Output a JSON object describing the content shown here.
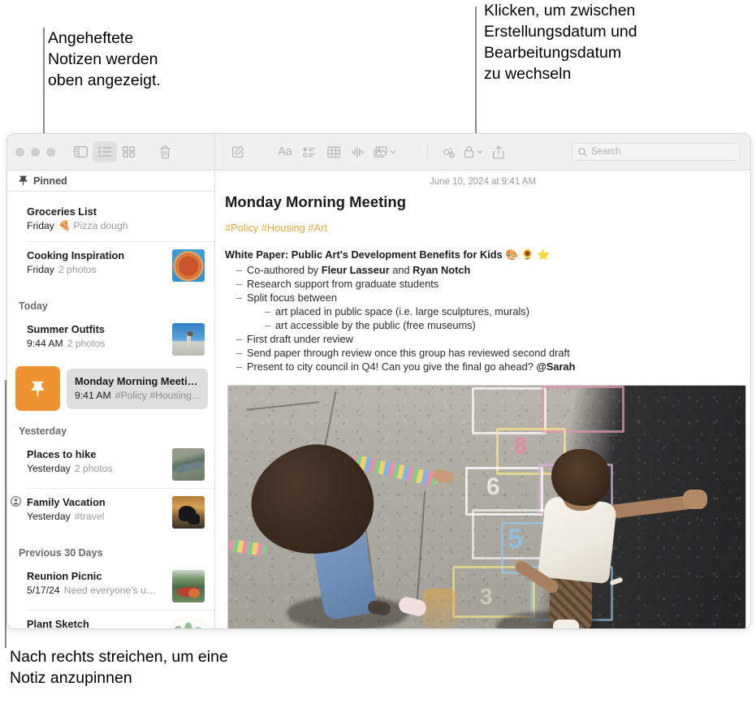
{
  "annotations": {
    "pinned_top": "Angeheftete\nNotizen werden\noben angezeigt.",
    "date_toggle": "Klicken, um zwischen\nErstellungsdatum und\nBearbeitungsdatum\nzu wechseln",
    "swipe_to_pin": "Nach rechts streichen, um eine\nNotiz anzupinnen"
  },
  "toolbar": {
    "icons": [
      {
        "name": "sidebar-toggle-icon",
        "label": "Sidebar"
      },
      {
        "name": "list-view-icon",
        "label": "List View"
      },
      {
        "name": "gallery-view-icon",
        "label": "Gallery View"
      },
      {
        "name": "delete-note-icon",
        "label": "Delete"
      },
      {
        "name": "compose-note-icon",
        "label": "New Note"
      },
      {
        "name": "format-text-icon",
        "label": "Aa"
      },
      {
        "name": "checklist-icon",
        "label": "Checklist"
      },
      {
        "name": "table-icon",
        "label": "Table"
      },
      {
        "name": "audio-icon",
        "label": "Audio"
      },
      {
        "name": "media-icon",
        "label": "Media"
      },
      {
        "name": "collaborate-icon",
        "label": "Collaborate"
      },
      {
        "name": "lock-note-icon",
        "label": "Lock"
      },
      {
        "name": "share-icon",
        "label": "Share"
      }
    ],
    "format_label": "Aa",
    "search_placeholder": "Search",
    "search_value": ""
  },
  "sidebar": {
    "pinned_header": "Pinned",
    "sections": [
      {
        "heading": "",
        "notes": [
          {
            "title": "Groceries List",
            "date": "Friday",
            "snippet": "🍕 Pizza dough",
            "has_thumb": false,
            "shared": false
          },
          {
            "title": "Cooking Inspiration",
            "date": "Friday",
            "snippet": "2 photos",
            "has_thumb": true,
            "shared": false
          }
        ]
      },
      {
        "heading": "Today",
        "notes": [
          {
            "title": "Summer Outfits",
            "date": "9:44 AM",
            "snippet": "2 photos",
            "has_thumb": true,
            "shared": false
          }
        ]
      },
      {
        "heading": "Yesterday",
        "notes": [
          {
            "title": "Places to hike",
            "date": "Yesterday",
            "snippet": "2 photos",
            "has_thumb": true,
            "shared": false
          },
          {
            "title": "Family Vacation",
            "date": "Yesterday",
            "snippet": "#travel",
            "has_thumb": true,
            "shared": true
          }
        ]
      },
      {
        "heading": "Previous 30 Days",
        "notes": [
          {
            "title": "Reunion Picnic",
            "date": "5/17/24",
            "snippet": "Need everyone's u…",
            "has_thumb": true,
            "shared": false
          },
          {
            "title": "Plant Sketch",
            "date": "",
            "snippet": "",
            "has_thumb": true,
            "shared": false
          }
        ]
      }
    ],
    "selected_note": {
      "title": "Monday Morning Meeting",
      "date": "9:41 AM",
      "snippet": "#Policy #Housing…"
    },
    "pin_button_color": "#EE9330"
  },
  "editor": {
    "date": "June 10, 2024 at 9:41 AM",
    "heading": "Monday Morning Meeting",
    "tags": "#Policy #Housing #Art",
    "lede": "White Paper: Public Art's Development Benefits for Kids 🎨 🌻 ⭐",
    "tag_color": "#E8A63C",
    "list": [
      {
        "prefix": "Co-authored by ",
        "bold1": "Fleur Lasseur",
        "middle": " and ",
        "bold2": "Ryan Notch",
        "suffix": "",
        "children": []
      },
      {
        "prefix": "Research support from graduate students",
        "bold1": "",
        "middle": "",
        "bold2": "",
        "suffix": "",
        "children": []
      },
      {
        "prefix": "Split focus between",
        "bold1": "",
        "middle": "",
        "bold2": "",
        "suffix": "",
        "children": [
          "art placed in public space (i.e. large sculptures, murals)",
          "art accessible by the public (free museums)"
        ]
      },
      {
        "prefix": "First draft under review",
        "bold1": "",
        "middle": "",
        "bold2": "",
        "suffix": "",
        "children": []
      },
      {
        "prefix": "Send paper through review once this group has reviewed second draft",
        "bold1": "",
        "middle": "",
        "bold2": "",
        "suffix": "",
        "children": []
      },
      {
        "prefix": "Present to city council in Q4! Can you give the final go ahead? ",
        "bold1": "@Sarah",
        "middle": "",
        "bold2": "",
        "suffix": "",
        "children": []
      }
    ],
    "photo_alt": "Two children playing hopscotch on chalk-drawn asphalt"
  }
}
